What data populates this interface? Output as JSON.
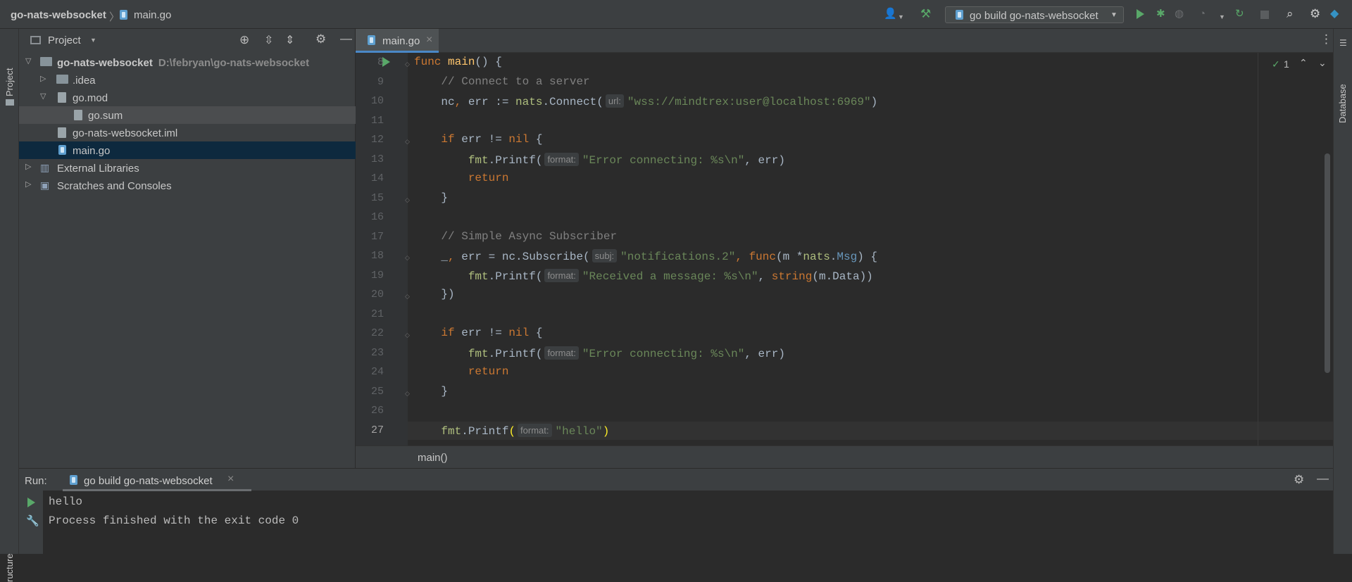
{
  "breadcrumb": {
    "project": "go-nats-websocket",
    "file": "main.go"
  },
  "toolbar": {
    "run_config": "go build go-nats-websocket"
  },
  "left_strip": {
    "project_label": "Project",
    "structure_label": "ructure"
  },
  "right_strip": {
    "database_label": "Database"
  },
  "project_panel": {
    "title": "Project",
    "tree": [
      {
        "label": "go-nats-websocket",
        "path": "D:\\febryan\\go-nats-websocket"
      },
      {
        "label": ".idea"
      },
      {
        "label": "go.mod"
      },
      {
        "label": "go.sum"
      },
      {
        "label": "go-nats-websocket.iml"
      },
      {
        "label": "main.go"
      },
      {
        "label": "External Libraries"
      },
      {
        "label": "Scratches and Consoles"
      }
    ]
  },
  "editor": {
    "tab": "main.go",
    "inspection_count": "1",
    "line_numbers": [
      "8",
      "9",
      "10",
      "11",
      "12",
      "13",
      "14",
      "15",
      "16",
      "17",
      "18",
      "19",
      "20",
      "21",
      "22",
      "23",
      "24",
      "25",
      "26",
      "27"
    ],
    "hints": {
      "url": "url:",
      "format": "format:",
      "subj": "subj:"
    },
    "strings": {
      "url": "\"wss://mindtrex:user@localhost:6969\"",
      "err_fmt": "\"Error connecting: %s\\n\"",
      "subj": "\"notifications.2\"",
      "recv_fmt": "\"Received a message: %s\\n\"",
      "hello": "\"hello\""
    },
    "comments": {
      "c1": "// Connect to a server",
      "c2": "// Simple Async Subscriber"
    },
    "breadcrumb_fn": "main()"
  },
  "run_panel": {
    "label": "Run:",
    "tab": "go build go-nats-websocket",
    "output": [
      "hello",
      "Process finished with the exit code 0"
    ]
  },
  "colors": {
    "keyword": "#cc7832",
    "string": "#6a8759",
    "function": "#ffc66d",
    "comment": "#808080",
    "accent": "#4a88c7",
    "run_green": "#59a869"
  }
}
